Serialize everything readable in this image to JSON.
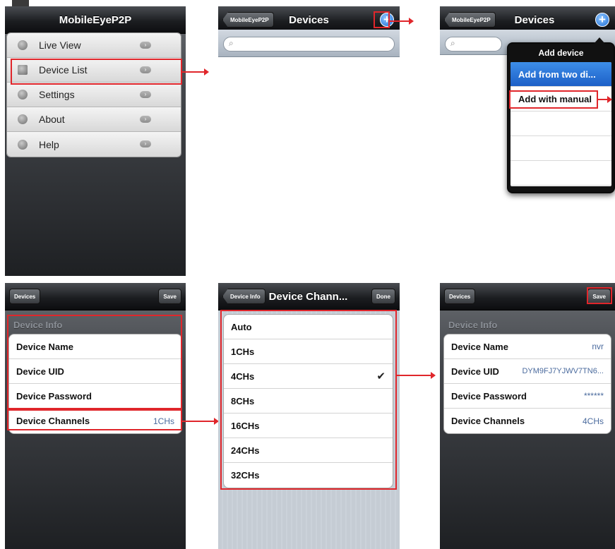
{
  "screen1": {
    "title": "MobileEyeP2P",
    "menu": [
      {
        "label": "Live View",
        "icon": "camera-icon"
      },
      {
        "label": "Device List",
        "icon": "device-list-icon"
      },
      {
        "label": "Settings",
        "icon": "gears-icon"
      },
      {
        "label": "About",
        "icon": "info-icon"
      },
      {
        "label": "Help",
        "icon": "help-icon"
      }
    ]
  },
  "screen2": {
    "back": "MobileEyeP2P",
    "title": "Devices",
    "search_placeholder": ""
  },
  "screen3": {
    "back": "MobileEyeP2P",
    "title": "Devices",
    "popover_title": "Add device",
    "popover_items": [
      "Add from two di...",
      "Add with manual",
      "",
      "",
      ""
    ]
  },
  "screen4": {
    "back": "Devices",
    "save": "Save",
    "section": "Device Info",
    "rows": [
      {
        "label": "Device Name",
        "value": ""
      },
      {
        "label": "Device UID",
        "value": ""
      },
      {
        "label": "Device Password",
        "value": ""
      },
      {
        "label": "Device Channels",
        "value": "1CHs"
      }
    ]
  },
  "screen5": {
    "back": "Device Info",
    "title": "Device Chann...",
    "done": "Done",
    "options": [
      "Auto",
      "1CHs",
      "4CHs",
      "8CHs",
      "16CHs",
      "24CHs",
      "32CHs"
    ],
    "selected_index": 2,
    "check": "✔"
  },
  "screen6": {
    "back": "Devices",
    "save": "Save",
    "section": "Device Info",
    "rows": [
      {
        "label": "Device Name",
        "value": "nvr"
      },
      {
        "label": "Device UID",
        "value": "DYM9FJ7YJWV7TN6..."
      },
      {
        "label": "Device Password",
        "value": "******"
      },
      {
        "label": "Device Channels",
        "value": "4CHs"
      }
    ]
  },
  "colors": {
    "highlight": "#e0262b",
    "accent_blue": "#1f6fd6"
  }
}
